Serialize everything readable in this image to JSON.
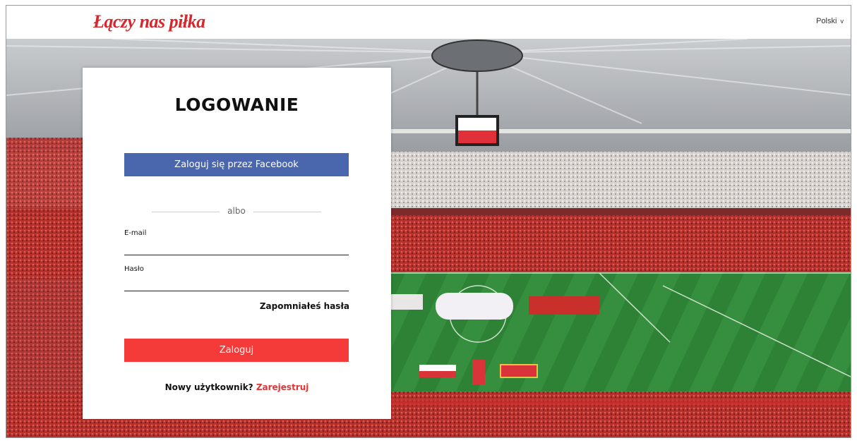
{
  "header": {
    "brand": "Łączy nas piłka",
    "language": "Polski",
    "language_chevron": "v"
  },
  "login": {
    "title": "LOGOWANIE",
    "facebook_button": "Zaloguj się przez Facebook",
    "divider": "albo",
    "email_label": "E-mail",
    "email_value": "",
    "password_label": "Hasło",
    "password_value": "",
    "forgot_password": "Zapomniałeś hasła",
    "submit_button": "Zaloguj",
    "new_user_text": "Nowy użytkownik?",
    "register_link": "Zarejestruj"
  },
  "colors": {
    "brand_red": "#d7262c",
    "facebook_blue": "#4a66ac",
    "submit_red": "#f53a3a",
    "link_red": "#e03434"
  },
  "icons": {
    "background": "stadium-photo",
    "language": "chevron-down-icon"
  }
}
